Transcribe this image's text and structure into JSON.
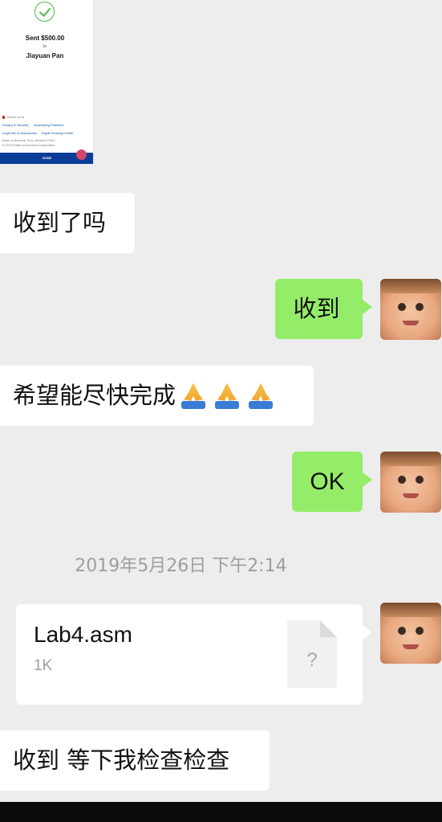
{
  "receipt": {
    "amount_line": "Sent $500.00",
    "to_label": "to",
    "payee": "Jiayuan Pan",
    "secure_area": "Secure Area",
    "link_privacy": "Privacy & Security",
    "link_advertising": "Advertising Practices",
    "link_legal": "Legal Info & Disclosures",
    "link_housing": "Equal Housing Lender",
    "footer_1": "Bank of America, N.A. Member FDIC.",
    "footer_2": "© 2019 Bank of America Corporation.",
    "done_label": "DONE"
  },
  "messages": [
    {
      "side": "received",
      "text": "收到了吗"
    },
    {
      "side": "sent",
      "text": "收到"
    },
    {
      "side": "received",
      "text": "希望能尽快完成"
    },
    {
      "side": "sent",
      "text": "OK"
    },
    {
      "side": "timestamp",
      "text": "2019年5月26日 下午2:14"
    },
    {
      "side": "sent-file",
      "file_name": "Lab4.asm",
      "file_size": "1K",
      "file_icon_glyph": "?"
    },
    {
      "side": "received",
      "text": "收到 等下我检查检查"
    }
  ],
  "icons": {
    "emoji": "folded-hands-icon",
    "avatar": "baby-face-avatar",
    "file": "unknown-file-icon"
  },
  "colors": {
    "background": "#ededed",
    "sent_bubble": "#95ec69",
    "received_bubble": "#ffffff",
    "timestamp": "#9e9e9e"
  }
}
